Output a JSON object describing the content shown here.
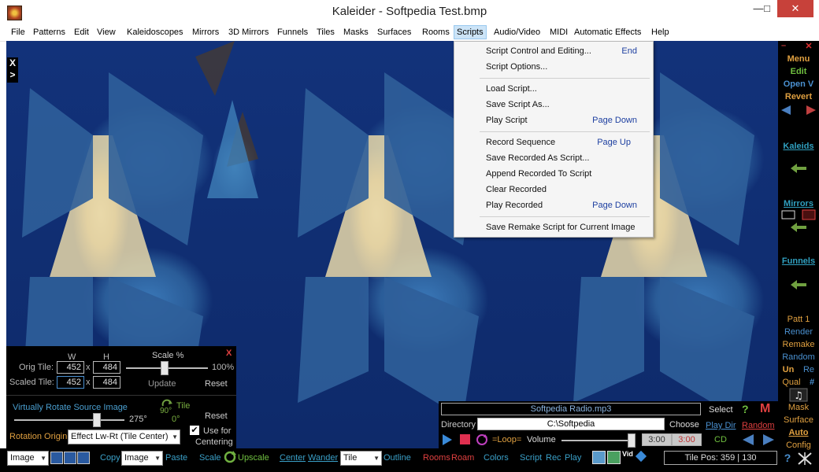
{
  "window": {
    "title": "Kaleider - Softpedia Test.bmp",
    "minimize": "—",
    "maximize": "□",
    "close": "✕"
  },
  "menu": [
    "File",
    "Patterns",
    "Edit",
    "View",
    "Kaleidoscopes",
    "Mirrors",
    "3D Mirrors",
    "Funnels",
    "Tiles",
    "Masks",
    "Surfaces",
    "Rooms",
    "Scripts",
    "Audio/Video",
    "MIDI",
    "Automatic Effects",
    "Help"
  ],
  "scripts_menu": {
    "items": [
      {
        "label": "Script Control and Editing...",
        "shortcut": "End"
      },
      {
        "label": "Script Options...",
        "shortcut": ""
      },
      {
        "label": "Load Script...",
        "shortcut": ""
      },
      {
        "label": "Save Script As...",
        "shortcut": ""
      },
      {
        "label": "Play Script",
        "shortcut": "Page Down"
      },
      {
        "label": "Record Sequence",
        "shortcut": "Page Up"
      },
      {
        "label": "Save Recorded As Script...",
        "shortcut": ""
      },
      {
        "label": "Append Recorded To Script",
        "shortcut": ""
      },
      {
        "label": "Clear Recorded",
        "shortcut": ""
      },
      {
        "label": "Play Recorded",
        "shortcut": "Page Down"
      },
      {
        "label": "Save Remake Script for Current Image",
        "shortcut": ""
      }
    ]
  },
  "canvas_overlay": {
    "x_label": "X",
    "arrow_label": ">"
  },
  "right_panel": {
    "minus": "–",
    "close": "✕",
    "menu": "Menu",
    "edit": "Edit",
    "open": "Open V",
    "revert": "Revert",
    "kaleids": "Kaleids",
    "mirrors": "Mirrors",
    "funnels": "Funnels",
    "patt": "Patt 1",
    "render": "Render",
    "remake": "Remake",
    "random": "Random",
    "un": "Un",
    "re": "Re",
    "qual": "Qual",
    "hash": "#",
    "mask": "Mask",
    "surface": "Surface",
    "auto": "Auto",
    "config": "Config",
    "help": "?"
  },
  "tile_panel": {
    "close": "X",
    "w_label": "W",
    "h_label": "H",
    "scale_label": "Scale %",
    "orig_label": "Orig Tile:",
    "orig_w": "452",
    "orig_h": "484",
    "scaled_label": "Scaled Tile:",
    "scaled_w": "452",
    "scaled_h": "484",
    "x": "x",
    "scale_value": "100%",
    "update": "Update",
    "reset": "Reset",
    "rotate_label": "Virtually Rotate Source Image",
    "rotate_value": "275°",
    "rot90_tile": "Tile",
    "rot90": "90°",
    "rot0": "0°",
    "rotate_reset": "Reset",
    "origin_label": "Rotation Origin",
    "origin_value": "Effect Lw-Rt (Tile Center)",
    "use_for": "Use for",
    "centering": "Centering"
  },
  "media_player": {
    "track": "Softpedia Radio.mp3",
    "select": "Select",
    "help": "?",
    "m": "M",
    "directory_label": "Directory",
    "directory_value": "C:\\Softpedia",
    "choose": "Choose",
    "play_dir": "Play Dir",
    "random": "Random",
    "loop": "=Loop=",
    "volume": "Volume",
    "time1": "3:00",
    "time2": "3:00",
    "cd": "CD"
  },
  "bottom_bar": {
    "image_sel": "Image",
    "copy": "Copy",
    "image_sel2": "Image",
    "paste": "Paste",
    "scale": "Scale",
    "upscale": "Upscale",
    "center": "Center",
    "wander": "Wander",
    "tile_sel": "Tile",
    "outline": "Outline",
    "rooms": "Rooms",
    "roam": "Roam",
    "colors": "Colors",
    "script": "Script",
    "rec": "Rec",
    "play": "Play",
    "vid": "Vid",
    "tile_pos": "Tile Pos:  359 | 130",
    "help": "?"
  }
}
